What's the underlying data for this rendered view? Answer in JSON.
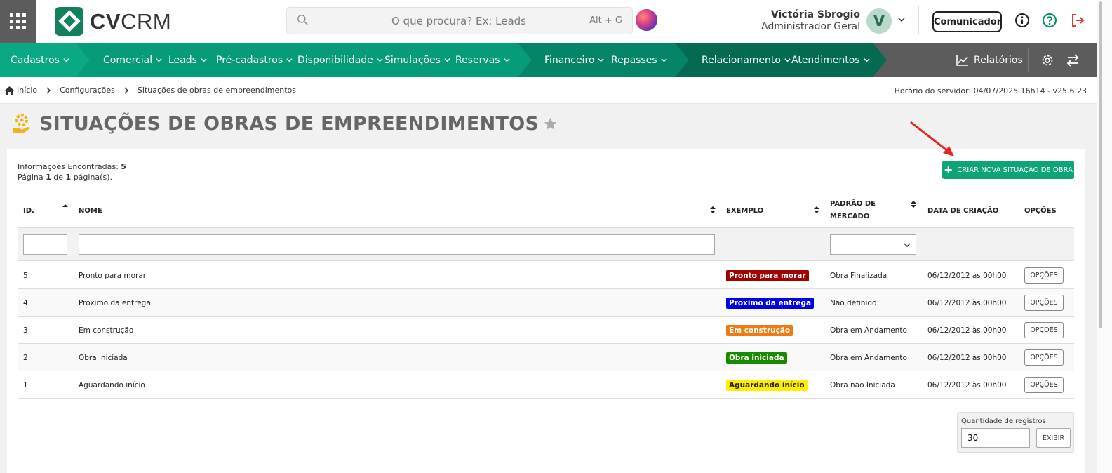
{
  "header": {
    "logo_text_bold": "CV",
    "logo_text": "CRM",
    "search_placeholder": "O que procura? Ex: Leads",
    "search_shortcut": "Alt + G",
    "user_name": "Victória Sbrogio",
    "user_role": "Administrador Geral",
    "avatar_initial": "V",
    "comunicador_label": "Comunicador"
  },
  "nav": {
    "items": [
      {
        "label": "Cadastros"
      },
      {
        "label": "Comercial"
      },
      {
        "label": "Leads"
      },
      {
        "label": "Pré-cadastros"
      },
      {
        "label": "Disponibilidade"
      },
      {
        "label": "Simulações"
      },
      {
        "label": "Reservas"
      },
      {
        "label": "Financeiro"
      },
      {
        "label": "Repasses"
      },
      {
        "label": "Relacionamento"
      },
      {
        "label": "Atendimentos"
      }
    ],
    "reports_label": "Relatórios",
    "colors": {
      "bg": "#5c5c5c",
      "seg1": "#0aa884",
      "seg2": "#079c79",
      "seg3": "#058567",
      "seg4": "#046b52"
    }
  },
  "breadcrumb": {
    "items": [
      {
        "label": "Início"
      },
      {
        "label": "Configurações"
      },
      {
        "label": "Situações de obras de empreendimentos"
      }
    ],
    "server_time": "Horário do servidor: 04/07/2025 16h14 - v25.6.23"
  },
  "page": {
    "title": "SITUAÇÕES DE OBRAS DE EMPREENDIMENTOS",
    "info_found_label": "Informações Encontradas: ",
    "info_found_count": "5",
    "page_word": "Página ",
    "page_current": "1",
    "page_of": " de ",
    "page_total": "1",
    "page_suffix": " página(s).",
    "create_button": "CRIAR NOVA SITUAÇÃO DE OBRA",
    "accent_color": "#0fa378"
  },
  "table": {
    "headers": {
      "id": "ID.",
      "nome": "NOME",
      "exemplo": "EXEMPLO",
      "padrao_line1": "PADRÃO DE",
      "padrao_line2": "MERCADO",
      "data": "DATA DE CRIAÇÃO",
      "opcoes": "OPÇÕES"
    },
    "rows": [
      {
        "id": "5",
        "nome": "Pronto para morar",
        "exemplo": "Pronto para morar",
        "badge_bg": "#a30000",
        "badge_fg": "#ffffff",
        "padrao": "Obra Finalizada",
        "data": "06/12/2012 às 00h00",
        "opcoes": "OPÇÕES"
      },
      {
        "id": "4",
        "nome": "Proximo da entrega",
        "exemplo": "Proximo da entrega",
        "badge_bg": "#0000e6",
        "badge_fg": "#ffffff",
        "padrao": "Não definido",
        "data": "06/12/2012 às 00h00",
        "opcoes": "OPÇÕES"
      },
      {
        "id": "3",
        "nome": "Em construção",
        "exemplo": "Em construção",
        "badge_bg": "#ef7a10",
        "badge_fg": "#ffffff",
        "padrao": "Obra em Andamento",
        "data": "06/12/2012 às 00h00",
        "opcoes": "OPÇÕES"
      },
      {
        "id": "2",
        "nome": "Obra iniciada",
        "exemplo": "Obra iniciada",
        "badge_bg": "#1a8a00",
        "badge_fg": "#ffffff",
        "padrao": "Obra em Andamento",
        "data": "06/12/2012 às 00h00",
        "opcoes": "OPÇÕES"
      },
      {
        "id": "1",
        "nome": "Aguardando início",
        "exemplo": "Aguardando início",
        "badge_bg": "#ffee00",
        "badge_fg": "#222222",
        "padrao": "Obra não Iniciada",
        "data": "06/12/2012 às 00h00",
        "opcoes": "OPÇÕES"
      }
    ]
  },
  "footer": {
    "qty_label": "Quantidade de registros:",
    "qty_value": "30",
    "show_button": "EXIBIR"
  }
}
